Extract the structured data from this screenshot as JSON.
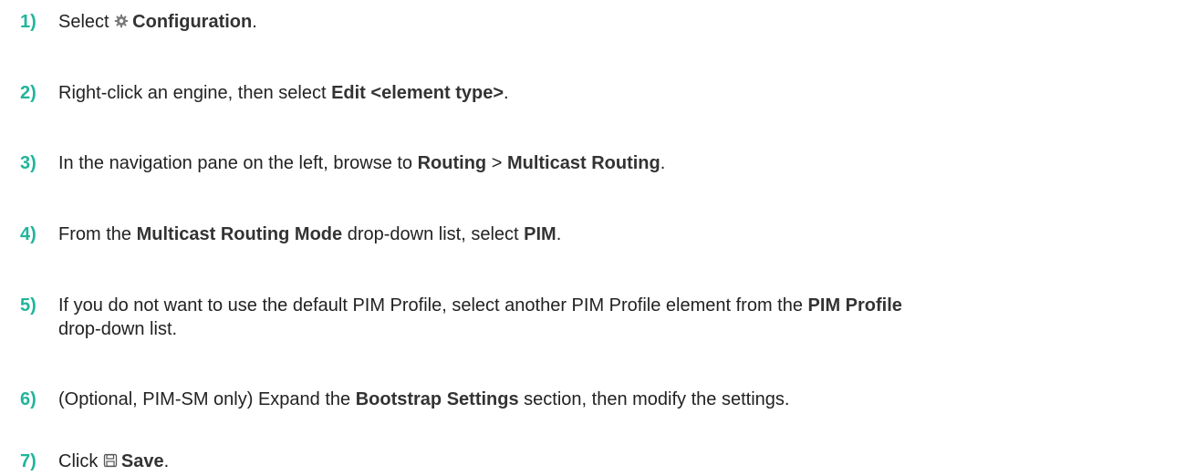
{
  "steps": [
    {
      "number": "1)",
      "prefix": "Select",
      "icon": "gear-icon",
      "bold": "Configuration",
      "suffix": "."
    },
    {
      "number": "2)",
      "prefix": "Right-click an engine, then select",
      "bold": "Edit <element type>",
      "suffix": "."
    },
    {
      "number": "3)",
      "prefix": "In the navigation pane on the left, browse to",
      "bold1": "Routing",
      "middle": ">",
      "bold2": "Multicast Routing",
      "suffix": "."
    },
    {
      "number": "4)",
      "prefix": "From the",
      "bold1": "Multicast Routing Mode",
      "middle": "drop-down list, select",
      "bold2": "PIM",
      "suffix": "."
    },
    {
      "number": "5)",
      "prefix": "If you do not want to use the default PIM Profile, select another PIM Profile element from the",
      "bold": "PIM Profile",
      "line2": "drop-down list."
    },
    {
      "number": "6)",
      "prefix": "(Optional, PIM-SM only) Expand the",
      "bold": "Bootstrap Settings",
      "suffix": "section, then modify the settings."
    },
    {
      "number": "7)",
      "prefix": "Click",
      "icon": "save-icon",
      "bold": "Save",
      "suffix": "."
    }
  ],
  "colors": {
    "step_number": "#20b59b",
    "text": "#222222",
    "icon": "#7a7a7a"
  }
}
